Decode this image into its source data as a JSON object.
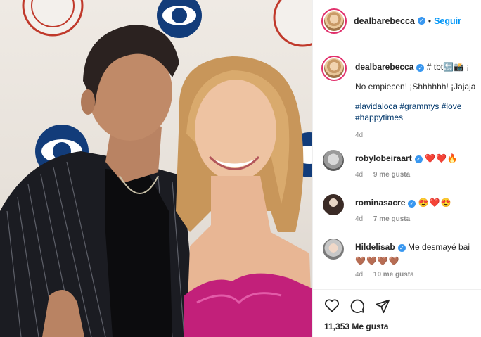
{
  "post": {
    "username": "dealbarebecca",
    "follow_label": "Seguir",
    "separator": "•",
    "caption_line1": "# tbt🔙📸 ¡",
    "caption_line2": "No empiecen! ¡Shhhhhh! ¡Jajaja",
    "hashtags_line1": "#lavidaloca #grammys #love",
    "hashtags_line2": "#happytimes",
    "caption_age": "4d",
    "likes_text": "11,353 Me gusta"
  },
  "comments": [
    {
      "user": "robylobeiraart",
      "text": "❤️❤️🔥",
      "age": "4d",
      "likes": "9 me gusta"
    },
    {
      "user": "rominasacre",
      "text": "😍❤️😍",
      "age": "4d",
      "likes": "7 me gusta"
    },
    {
      "user": "Hildelisab",
      "text": "Me desmayé bai",
      "text2": "🤎🤎🤎🤎",
      "age": "4d",
      "likes": "10 me gusta"
    }
  ],
  "icons": {
    "verified": "verified-badge-icon",
    "like": "heart-icon",
    "comment": "comment-icon",
    "share": "paper-plane-icon"
  },
  "colors": {
    "accent": "#0095f6",
    "verified": "#3897f0",
    "text": "#262626",
    "muted": "#8e8e8e"
  }
}
